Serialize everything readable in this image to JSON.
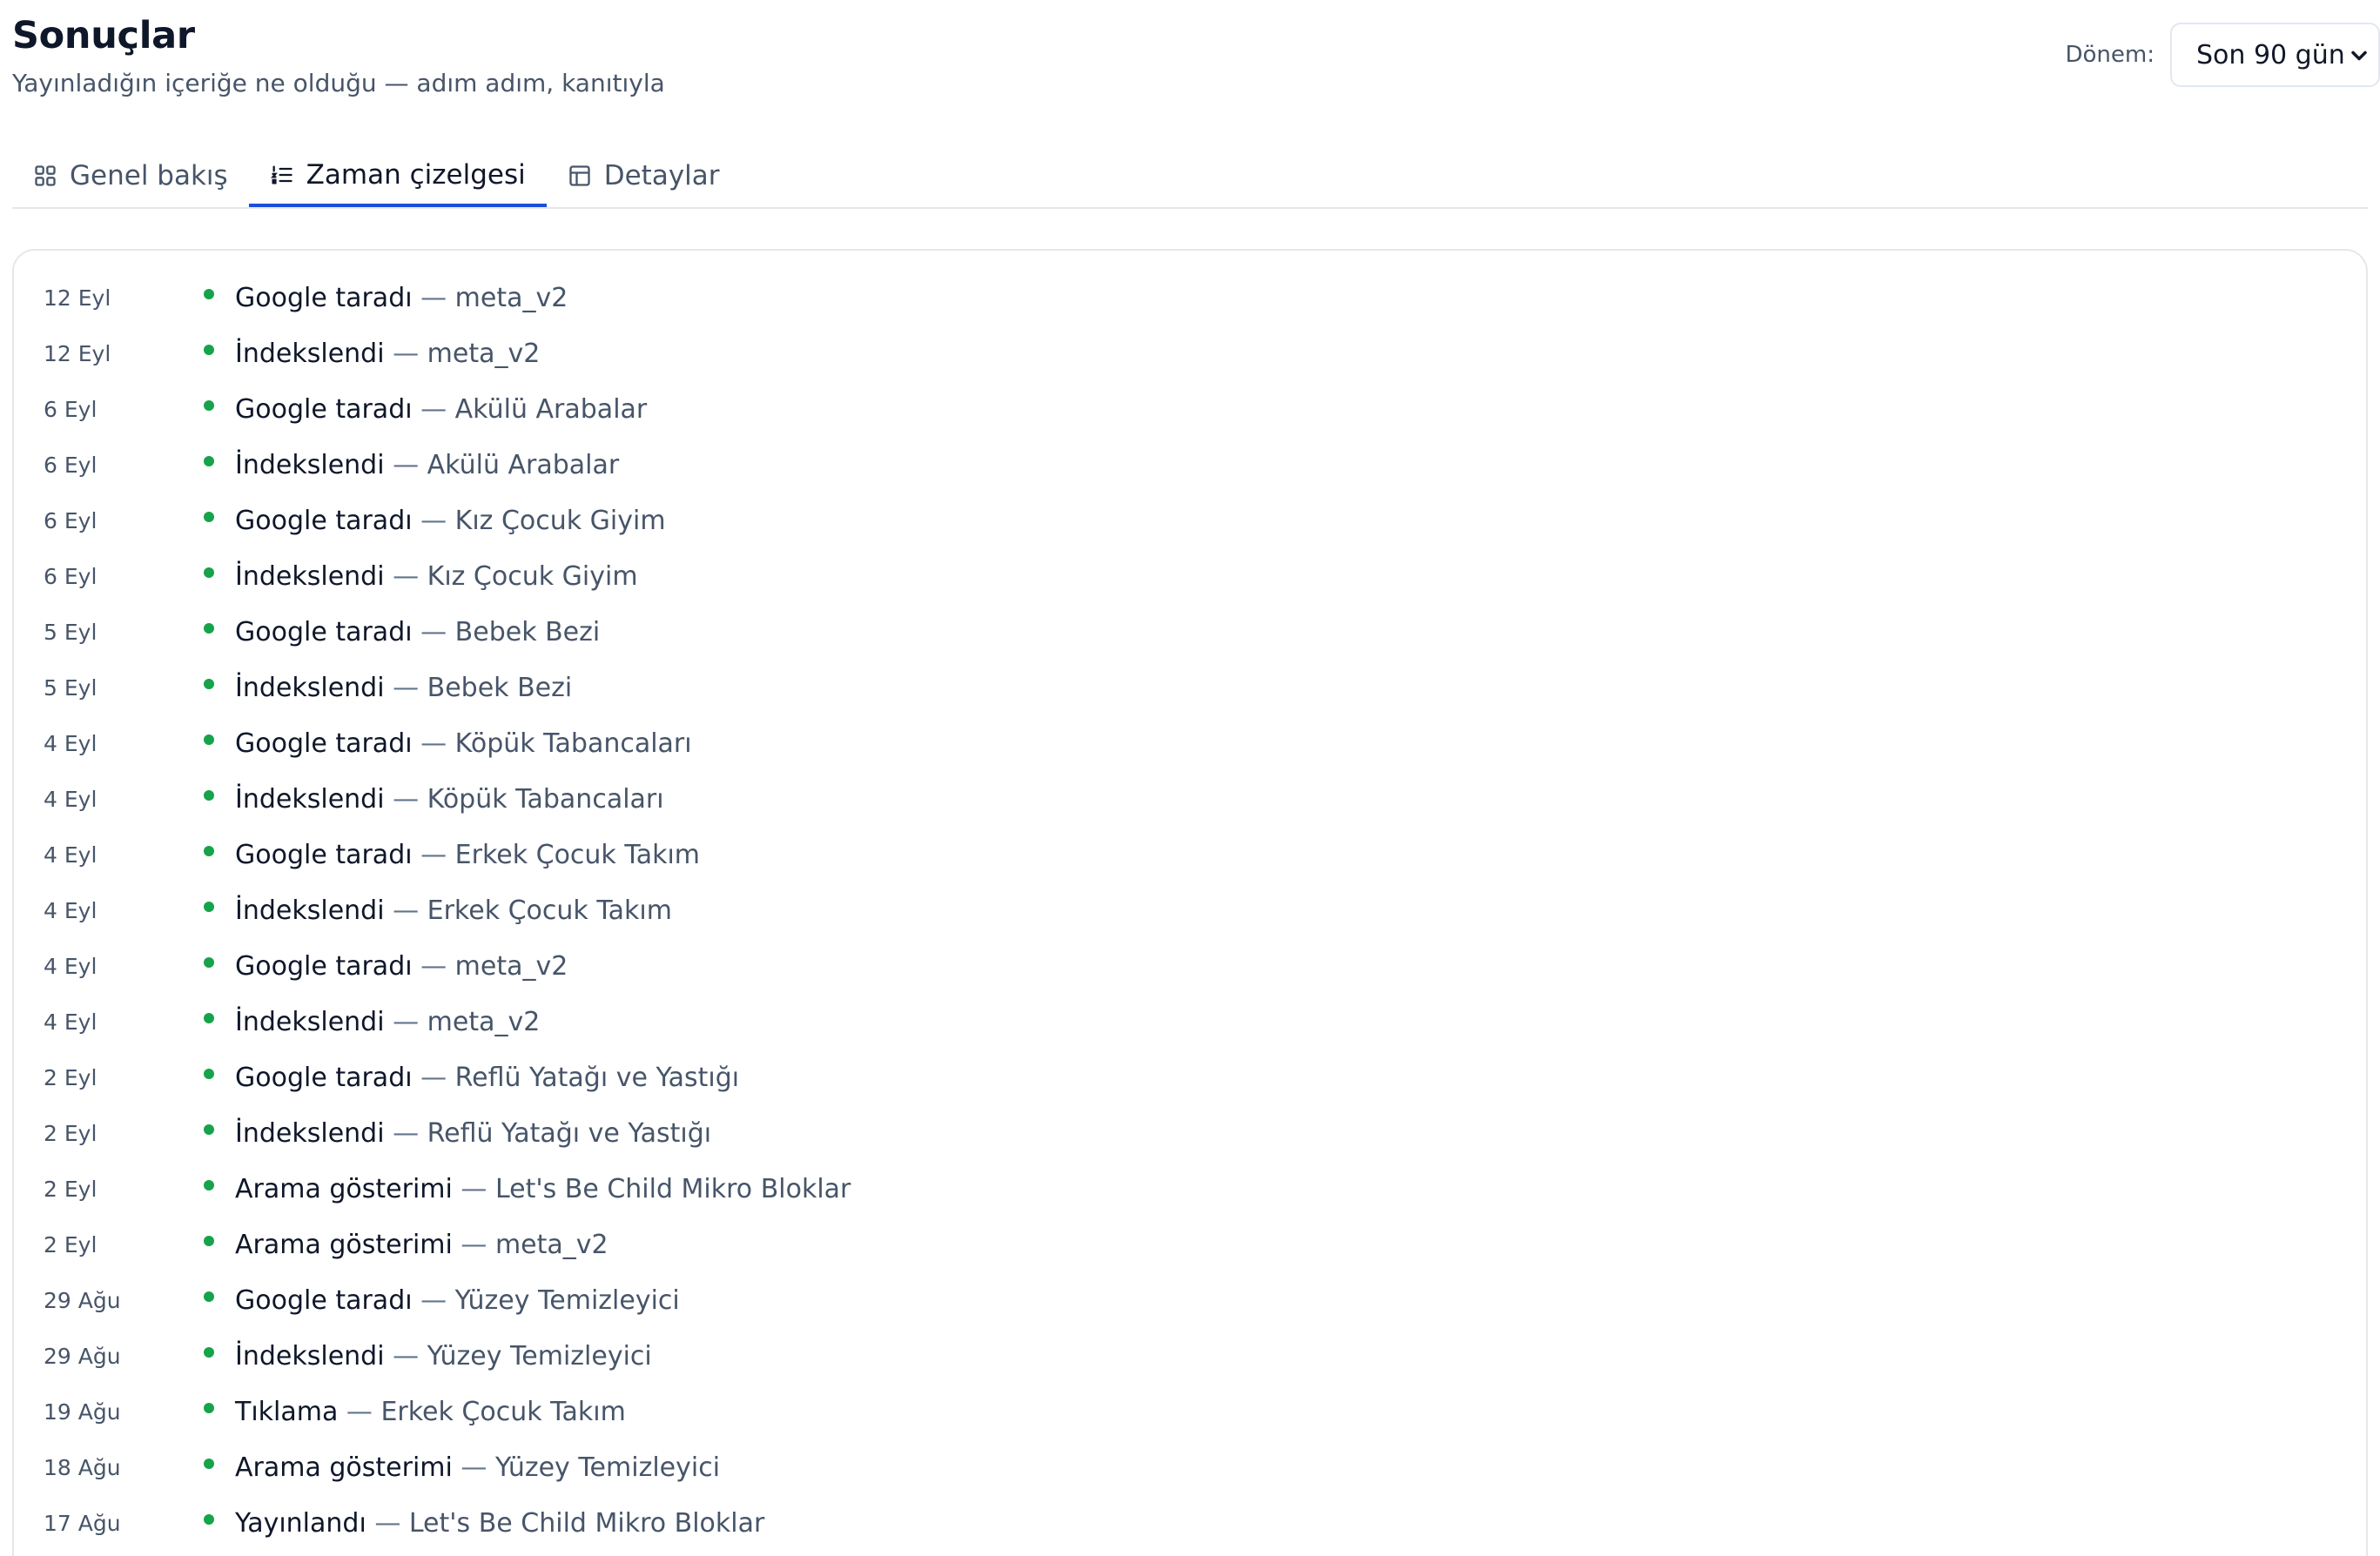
{
  "header": {
    "title": "Sonuçlar",
    "subtitle": "Yayınladığın içeriğe ne olduğu — adım adım, kanıtıyla"
  },
  "period": {
    "label": "Dönem:",
    "selected": "Son 90 gün"
  },
  "tabs": [
    {
      "label": "Genel bakış",
      "icon": "grid-icon",
      "active": false
    },
    {
      "label": "Zaman çizelgesi",
      "icon": "list-ordered-icon",
      "active": true
    },
    {
      "label": "Detaylar",
      "icon": "table-icon",
      "active": false
    }
  ],
  "colors": {
    "accent": "#1d4ed8",
    "dot": "#16a34a",
    "border": "#e5e7eb"
  },
  "timeline": {
    "separator": " — ",
    "rows": [
      {
        "date": "12 Eyl",
        "event": "Google taradı",
        "item": "meta_v2"
      },
      {
        "date": "12 Eyl",
        "event": "İndekslendi",
        "item": "meta_v2"
      },
      {
        "date": "6 Eyl",
        "event": "Google taradı",
        "item": "Akülü Arabalar"
      },
      {
        "date": "6 Eyl",
        "event": "İndekslendi",
        "item": "Akülü Arabalar"
      },
      {
        "date": "6 Eyl",
        "event": "Google taradı",
        "item": "Kız Çocuk Giyim"
      },
      {
        "date": "6 Eyl",
        "event": "İndekslendi",
        "item": "Kız Çocuk Giyim"
      },
      {
        "date": "5 Eyl",
        "event": "Google taradı",
        "item": "Bebek Bezi"
      },
      {
        "date": "5 Eyl",
        "event": "İndekslendi",
        "item": "Bebek Bezi"
      },
      {
        "date": "4 Eyl",
        "event": "Google taradı",
        "item": "Köpük Tabancaları"
      },
      {
        "date": "4 Eyl",
        "event": "İndekslendi",
        "item": "Köpük Tabancaları"
      },
      {
        "date": "4 Eyl",
        "event": "Google taradı",
        "item": "Erkek Çocuk Takım"
      },
      {
        "date": "4 Eyl",
        "event": "İndekslendi",
        "item": "Erkek Çocuk Takım"
      },
      {
        "date": "4 Eyl",
        "event": "Google taradı",
        "item": "meta_v2"
      },
      {
        "date": "4 Eyl",
        "event": "İndekslendi",
        "item": "meta_v2"
      },
      {
        "date": "2 Eyl",
        "event": "Google taradı",
        "item": "Reflü Yatağı ve Yastığı"
      },
      {
        "date": "2 Eyl",
        "event": "İndekslendi",
        "item": "Reflü Yatağı ve Yastığı"
      },
      {
        "date": "2 Eyl",
        "event": "Arama gösterimi",
        "item": "Let's Be Child Mikro Bloklar"
      },
      {
        "date": "2 Eyl",
        "event": "Arama gösterimi",
        "item": "meta_v2"
      },
      {
        "date": "29 Ağu",
        "event": "Google taradı",
        "item": "Yüzey Temizleyici"
      },
      {
        "date": "29 Ağu",
        "event": "İndekslendi",
        "item": "Yüzey Temizleyici"
      },
      {
        "date": "19 Ağu",
        "event": "Tıklama",
        "item": "Erkek Çocuk Takım"
      },
      {
        "date": "18 Ağu",
        "event": "Arama gösterimi",
        "item": "Yüzey Temizleyici"
      },
      {
        "date": "17 Ağu",
        "event": "Yayınlandı",
        "item": "Let's Be Child Mikro Bloklar"
      }
    ]
  }
}
